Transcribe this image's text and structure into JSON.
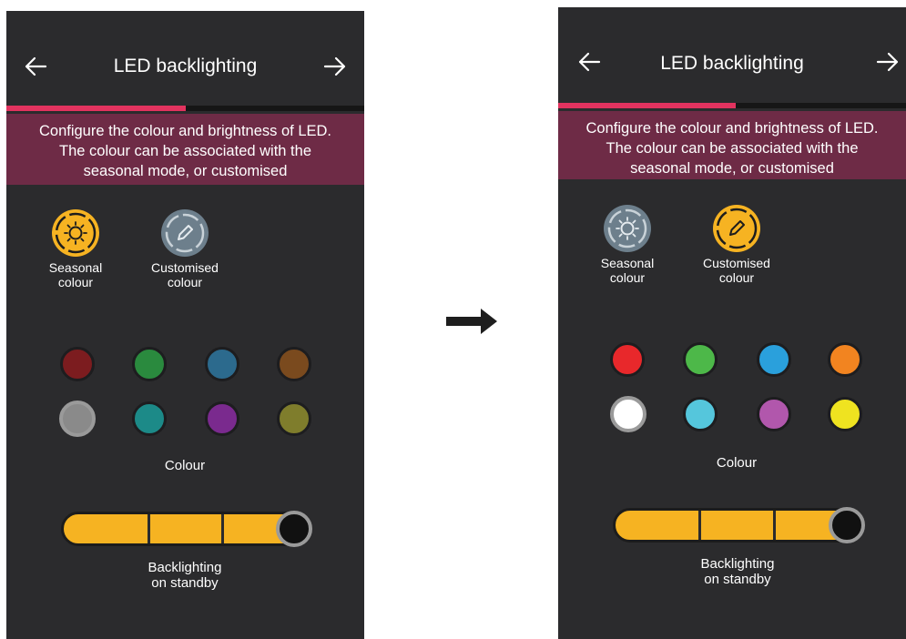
{
  "colors": {
    "screen_bg": "#2b2b2d",
    "accent_progress": "#e2335f",
    "banner_bg": "#6e2b46",
    "slider_fill": "#f6b322",
    "active_mode": "#f6b322",
    "inactive_mode": "#6d7f8c"
  },
  "left": {
    "header": {
      "title": "LED backlighting",
      "back_icon": "arrow-left-icon",
      "next_icon": "arrow-right-icon"
    },
    "progress_fraction": 0.5,
    "banner": {
      "line1": "Configure the colour and brightness of LED.",
      "line2": "The colour can be associated with the",
      "line3": "seasonal mode, or customised"
    },
    "modes": [
      {
        "line1": "Seasonal",
        "line2": "colour",
        "icon": "sun-moon-icon",
        "active": true
      },
      {
        "line1": "Customised",
        "line2": "colour",
        "icon": "pencil-icon",
        "active": false
      }
    ],
    "swatches": [
      "#7c1c1f",
      "#2a8a3e",
      "#2c6a8d",
      "#7a4a1e",
      "#8a8a8a",
      "#1c8a88",
      "#7a2a8e",
      "#7f7d2c"
    ],
    "selected_swatch": 4,
    "colour_label": "Colour",
    "slider_level": 1.0,
    "backlight_label": {
      "line1": "Backlighting",
      "line2": "on standby"
    }
  },
  "right": {
    "header": {
      "title": "LED backlighting",
      "back_icon": "arrow-left-icon",
      "next_icon": "arrow-right-icon"
    },
    "progress_fraction": 0.5,
    "banner": {
      "line1": "Configure the colour and brightness of LED.",
      "line2": "The colour can be associated with the",
      "line3": "seasonal mode, or customised"
    },
    "modes": [
      {
        "line1": "Seasonal",
        "line2": "colour",
        "icon": "sun-moon-icon",
        "active": false
      },
      {
        "line1": "Customised",
        "line2": "colour",
        "icon": "pencil-icon",
        "active": true
      }
    ],
    "swatches": [
      "#e8282b",
      "#4db849",
      "#2aa0dc",
      "#f28420",
      "#ffffff",
      "#55c6dc",
      "#b157ac",
      "#efe320"
    ],
    "selected_swatch": 4,
    "colour_label": "Colour",
    "slider_level": 1.0,
    "backlight_label": {
      "line1": "Backlighting",
      "line2": "on standby"
    }
  },
  "between_icon": "arrow-right-icon"
}
